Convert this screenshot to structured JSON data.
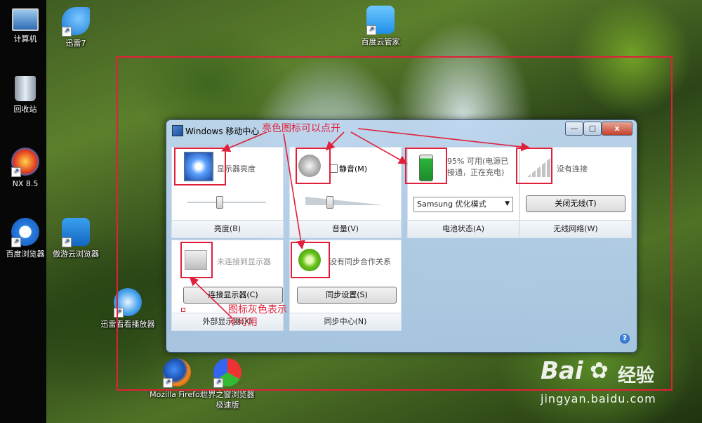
{
  "desktop": {
    "icons": [
      {
        "label": "计算机"
      },
      {
        "label": "迅雷7"
      },
      {
        "label": "百度云管家"
      },
      {
        "label": "回收站"
      },
      {
        "label": "NX 8.5"
      },
      {
        "label": "百度浏览器"
      },
      {
        "label": "傲游云浏览器"
      },
      {
        "label": "迅雷看看播放器"
      },
      {
        "label": "Mozilla Firefox"
      },
      {
        "label": "世界之窗浏览器极速版"
      }
    ]
  },
  "window": {
    "title": "Windows 移动中心",
    "controls": {
      "minimize": "—",
      "maximize": "□",
      "close": "x"
    },
    "tiles": {
      "display": {
        "label": "显示器亮度",
        "footer": "亮度(B)",
        "slider_value": 0.4
      },
      "volume": {
        "label": "静音(M)",
        "footer": "音量(V)",
        "mute_checked": false,
        "slider_value": 0.3
      },
      "battery": {
        "status": "95% 可用(电源已接通，正在充电)",
        "dropdown_value": "Samsung 优化模式",
        "footer": "电池状态(A)"
      },
      "wireless": {
        "status": "没有连接",
        "button": "关闭无线(T)",
        "footer": "无线网络(W)"
      },
      "external": {
        "status": "未连接到显示器",
        "button": "连接显示器(C)",
        "footer": "外部显示器(X)"
      },
      "sync": {
        "status": "没有同步合作关系",
        "button": "同步设置(S)",
        "footer": "同步中心(N)"
      }
    },
    "help": "?"
  },
  "annotations": {
    "bright_note": "亮色图标可以点开",
    "gray_note": "图标灰色表示不可用"
  },
  "watermark": {
    "logo": "Bai",
    "cn": "经验",
    "url": "jingyan.baidu.com"
  },
  "colors": {
    "annotation": "#e0203a",
    "accent": "#1f5fbf"
  }
}
